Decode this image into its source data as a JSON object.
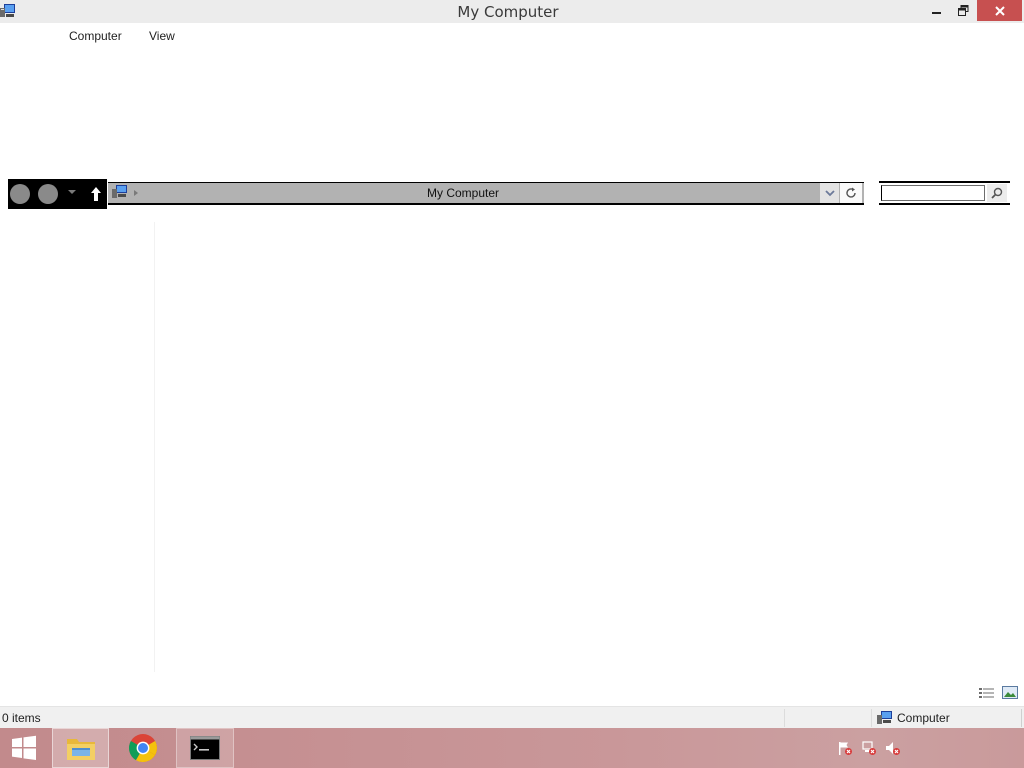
{
  "window": {
    "title": "My Computer",
    "icon": "computer-icon",
    "controls": [
      "minimize-icon",
      "restore-icon",
      "close-icon"
    ],
    "close_color": "#c75050"
  },
  "menu": {
    "items": [
      {
        "label": "Computer"
      },
      {
        "label": "View"
      }
    ]
  },
  "navigation": {
    "back_icon": "back-arrow-icon",
    "forward_icon": "forward-arrow-icon",
    "recent_icon": "chevron-down-icon",
    "up_icon": "up-arrow-icon"
  },
  "address": {
    "location": "My Computer",
    "location_icon": "computer-icon",
    "dropdown_icon": "chevron-down-icon",
    "refresh_icon": "refresh-icon"
  },
  "search": {
    "value": "",
    "placeholder": "",
    "icon": "search-icon"
  },
  "view_toggles": {
    "details_icon": "details-view-icon",
    "large_icon": "large-icons-view-icon"
  },
  "status": {
    "item_count": "0 items",
    "zone_label": "Computer",
    "zone_icon": "computer-icon"
  },
  "taskbar": {
    "start_icon": "windows-logo-icon",
    "apps": [
      {
        "name": "file-explorer",
        "icon": "folder-icon",
        "active": true
      },
      {
        "name": "chrome",
        "icon": "chrome-icon",
        "active": false
      },
      {
        "name": "command-prompt",
        "icon": "cmd-icon",
        "active": true
      }
    ],
    "tray": [
      "action-center-flag-icon",
      "network-icon",
      "volume-muted-icon"
    ]
  }
}
